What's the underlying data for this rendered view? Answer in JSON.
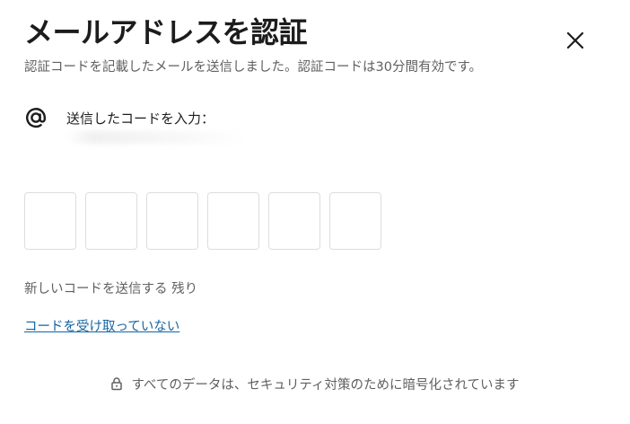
{
  "dialog": {
    "title": "メールアドレスを認証",
    "subtitle": "認証コードを記載したメールを送信しました。認証コードは30分間有効です。",
    "close_icon": "close-icon"
  },
  "prompt": {
    "icon": "at-sign-icon",
    "label": "送信したコードを入力："
  },
  "code": {
    "digits": [
      "",
      "",
      "",
      "",
      "",
      ""
    ]
  },
  "resend": {
    "text": "新しいコードを送信する 残り"
  },
  "not_received_link": "コードを受け取っていない",
  "footer": {
    "icon": "lock-icon",
    "text": "すべてのデータは、セキュリティ対策のために暗号化されています"
  },
  "colors": {
    "text_primary": "#1d1c1d",
    "text_secondary": "#616061",
    "link": "#1264a3",
    "box_border": "#dddddd"
  }
}
